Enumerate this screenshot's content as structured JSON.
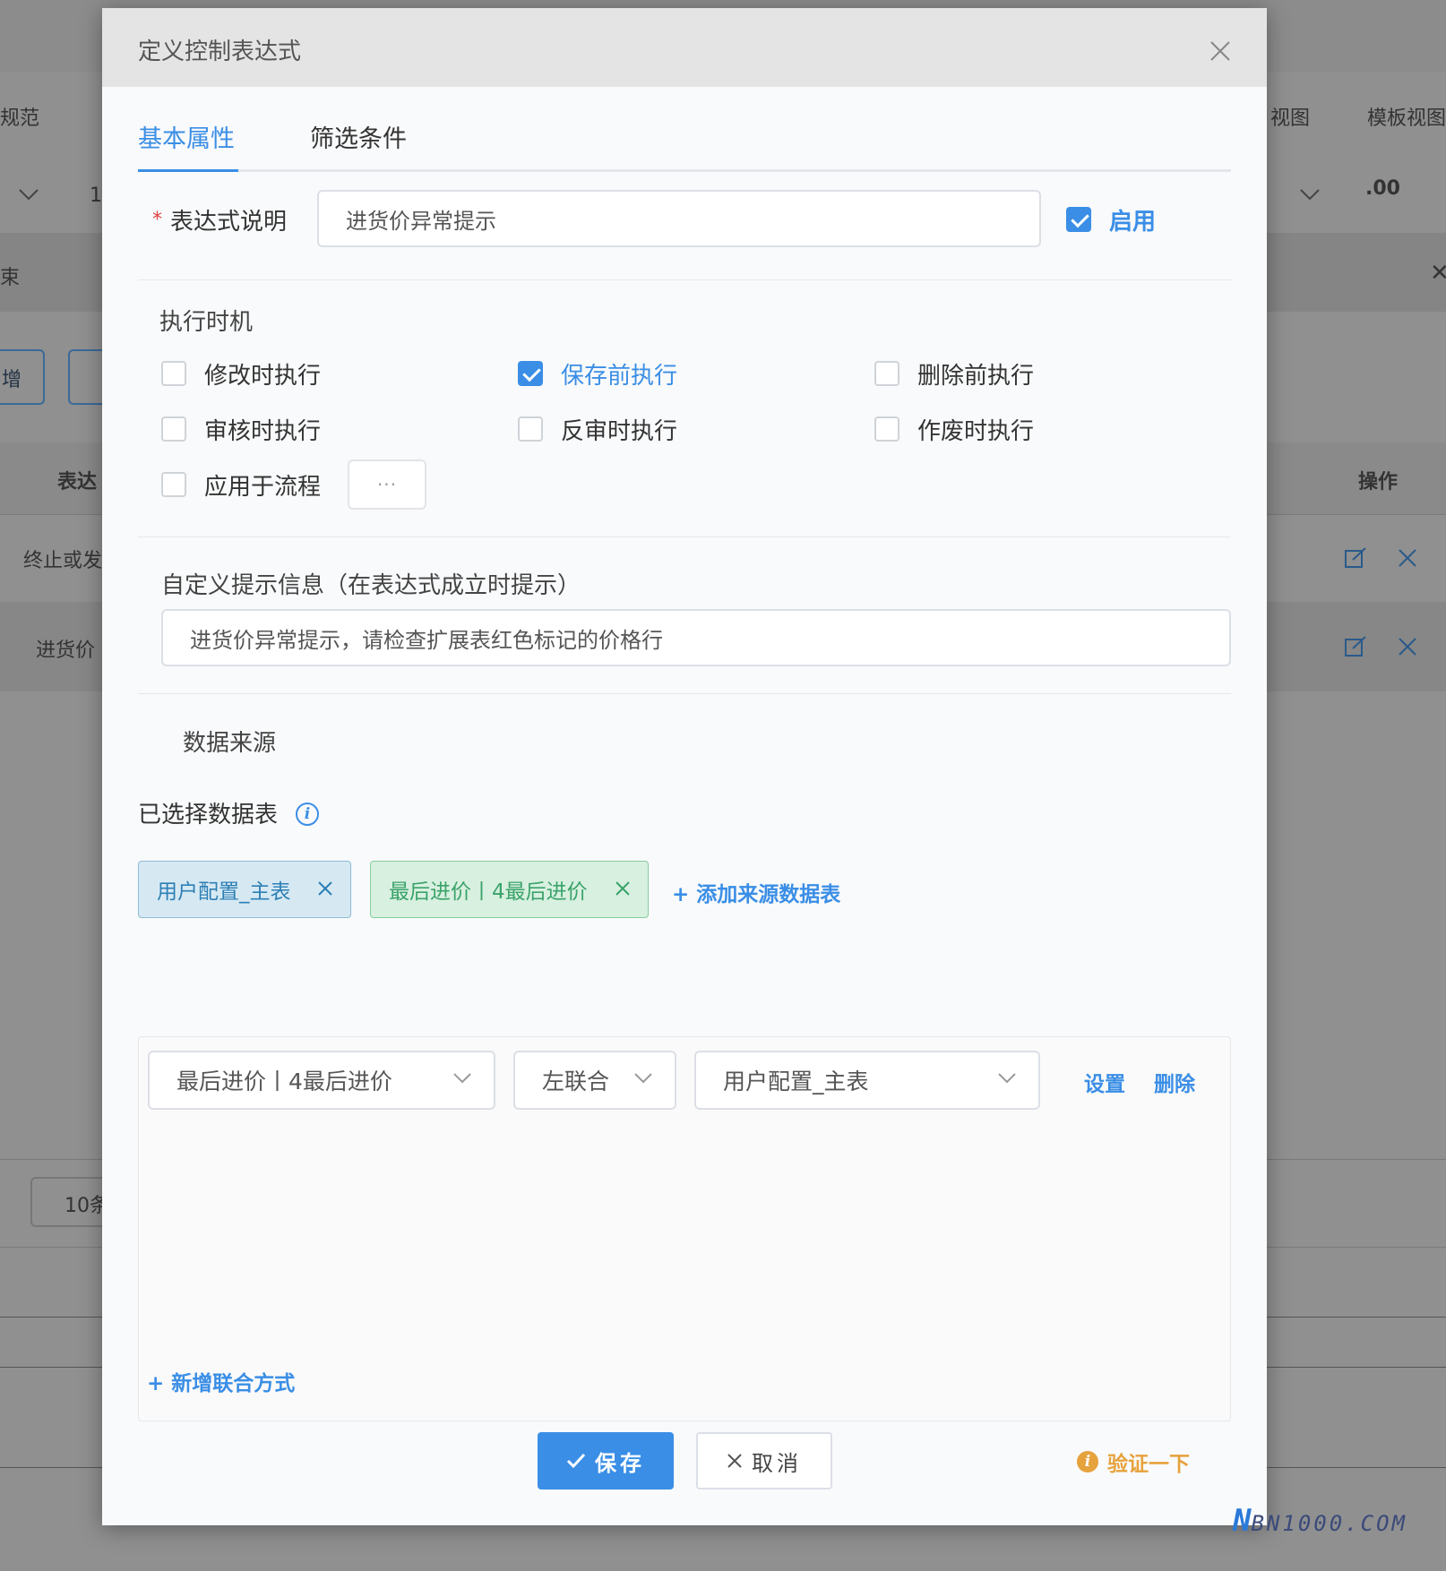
{
  "background": {
    "toolbar_left": "规范",
    "toolbar_right_1": "视图",
    "toolbar_right_2": "模板视图",
    "left_char_1": "1",
    "left_char_2": "束",
    "btn_partial": "增",
    "decimal_icon_text": ".00",
    "col_header_left": "表达",
    "col_header_ops": "操作",
    "row_1": "终止或发",
    "row_2": "进货价",
    "pager": "10条"
  },
  "dialog": {
    "title": "定义控制表达式",
    "tabs": [
      "基本属性",
      "筛选条件"
    ],
    "expression": {
      "label": "表达式说明",
      "value": "进货价异常提示",
      "enable_label": "启用",
      "enabled": true
    },
    "timing": {
      "label": "执行时机",
      "options": [
        {
          "label": "修改时执行",
          "checked": false
        },
        {
          "label": "保存前执行",
          "checked": true
        },
        {
          "label": "删除前执行",
          "checked": false
        },
        {
          "label": "审核时执行",
          "checked": false
        },
        {
          "label": "反审时执行",
          "checked": false
        },
        {
          "label": "作废时执行",
          "checked": false
        },
        {
          "label": "应用于流程",
          "checked": false
        }
      ],
      "more_label": "···"
    },
    "custom_tip": {
      "label": "自定义提示信息（在表达式成立时提示）",
      "value": "进货价异常提示，请检查扩展表红色标记的价格行"
    },
    "data_source": {
      "label": "数据来源",
      "selected_label": "已选择数据表",
      "tags": [
        "用户配置_主表",
        "最后进价丨4最后进价"
      ],
      "add_link": "+ 添加来源数据表"
    },
    "join": {
      "left_table": "最后进价丨4最后进价",
      "join_type": "左联合",
      "right_table": "用户配置_主表",
      "set_link": "设置",
      "delete_link": "删除",
      "add_link": "+ 新增联合方式"
    },
    "footer": {
      "save": "保存",
      "cancel": "取消",
      "verify": "验证一下"
    }
  },
  "watermark": {
    "logo": "N",
    "text": "BN1000.COM"
  },
  "colors": {
    "accent": "#3a8ee6",
    "warning": "#e6a23c",
    "tag_green": "#3aa36a"
  }
}
